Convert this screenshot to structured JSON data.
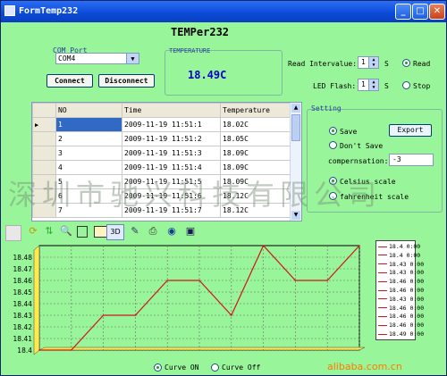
{
  "window": {
    "title": "FormTemp232"
  },
  "app_title": "TEMPer232",
  "com_port": {
    "label": "COM Port",
    "value": "COM4"
  },
  "temperature": {
    "label": "TEMPERATURE",
    "value": "18.49C"
  },
  "buttons": {
    "connect": "Connect",
    "disconnect": "Disconnect",
    "export": "Export"
  },
  "read_interval": {
    "label": "Read Intervalue:",
    "value": "1",
    "unit": "S",
    "mode_label": "Read"
  },
  "led_flash": {
    "label": "LED Flash:",
    "value": "1",
    "unit": "S",
    "mode_label": "Stop"
  },
  "setting": {
    "label": "Setting",
    "save": "Save",
    "dont_save": "Don't Save",
    "compensation_label": "compernsation:",
    "compensation_value": "-3",
    "celsius": "Celsius scale",
    "fahrenheit": "fahrenheit scale"
  },
  "table": {
    "headers": [
      "NO",
      "Time",
      "Temperature"
    ],
    "rows": [
      [
        "1",
        "2009-11-19 11:51:1",
        "18.02C"
      ],
      [
        "2",
        "2009-11-19 11:51:2",
        "18.05C"
      ],
      [
        "3",
        "2009-11-19 11:51:3",
        "18.09C"
      ],
      [
        "4",
        "2009-11-19 11:51:4",
        "18.09C"
      ],
      [
        "5",
        "2009-11-19 11:51:5",
        "18.09C"
      ],
      [
        "6",
        "2009-11-19 11:51:6",
        "18.12C"
      ],
      [
        "7",
        "2009-11-19 11:51:7",
        "18.12C"
      ]
    ]
  },
  "toolbar": {
    "view3d": "3D"
  },
  "curve": {
    "on": "Curve ON",
    "off": "Curve Off"
  },
  "watermark": "深圳市驰兴科技有限公司",
  "watermark2": "alibaba.com.cn",
  "colors": {
    "background": "#99f599",
    "line": "#d3141c",
    "title": "#0000cc"
  },
  "chart_data": {
    "type": "line",
    "y_ticks": [
      "18.48",
      "18.47",
      "18.46",
      "18.45",
      "18.44",
      "18.43",
      "18.42",
      "18.41",
      "18.4"
    ],
    "ylim": [
      18.4,
      18.49
    ],
    "values": [
      18.4,
      18.4,
      18.43,
      18.43,
      18.46,
      18.46,
      18.43,
      18.49,
      18.46,
      18.46,
      18.49
    ],
    "legend": [
      "18.4 0:00",
      "18.4 0:00",
      "18.43 0:00",
      "18.43 0:00",
      "18.46 0:00",
      "18.46 0:00",
      "18.43 0:00",
      "18.46 0:00",
      "18.46 0:00",
      "18.46 0:00",
      "18.49 0:00"
    ]
  }
}
